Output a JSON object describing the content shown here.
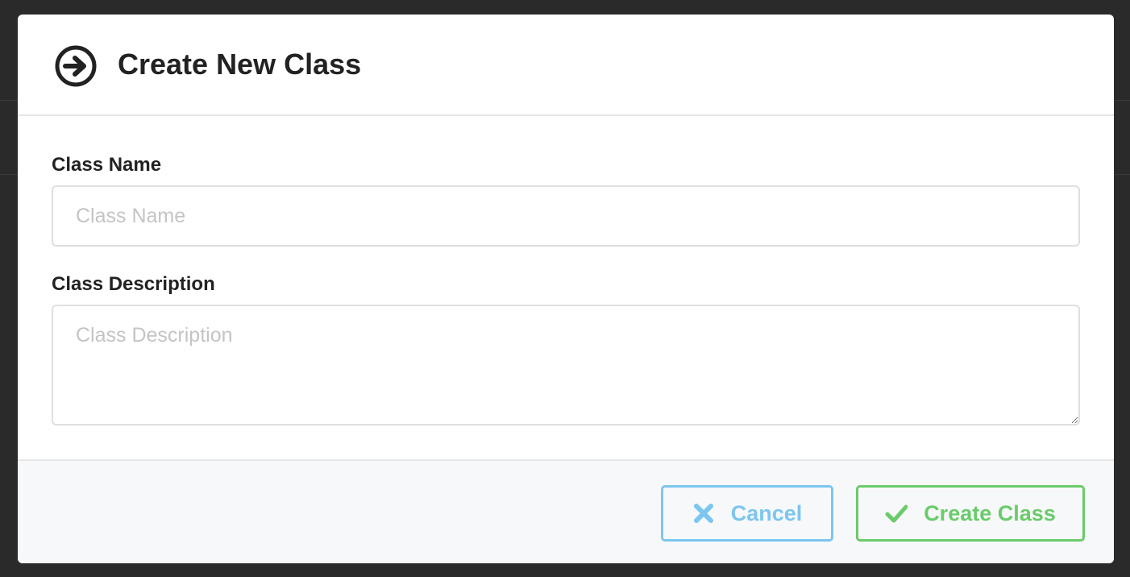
{
  "modal": {
    "title": "Create New Class",
    "header_icon": "arrow-circle-right-icon"
  },
  "form": {
    "class_name": {
      "label": "Class Name",
      "placeholder": "Class Name",
      "value": ""
    },
    "class_description": {
      "label": "Class Description",
      "placeholder": "Class Description",
      "value": ""
    }
  },
  "footer": {
    "cancel": {
      "label": "Cancel",
      "icon": "close-icon",
      "color": "#7cc6ef"
    },
    "create": {
      "label": "Create Class",
      "icon": "checkmark-icon",
      "color": "#6acb6a"
    }
  }
}
